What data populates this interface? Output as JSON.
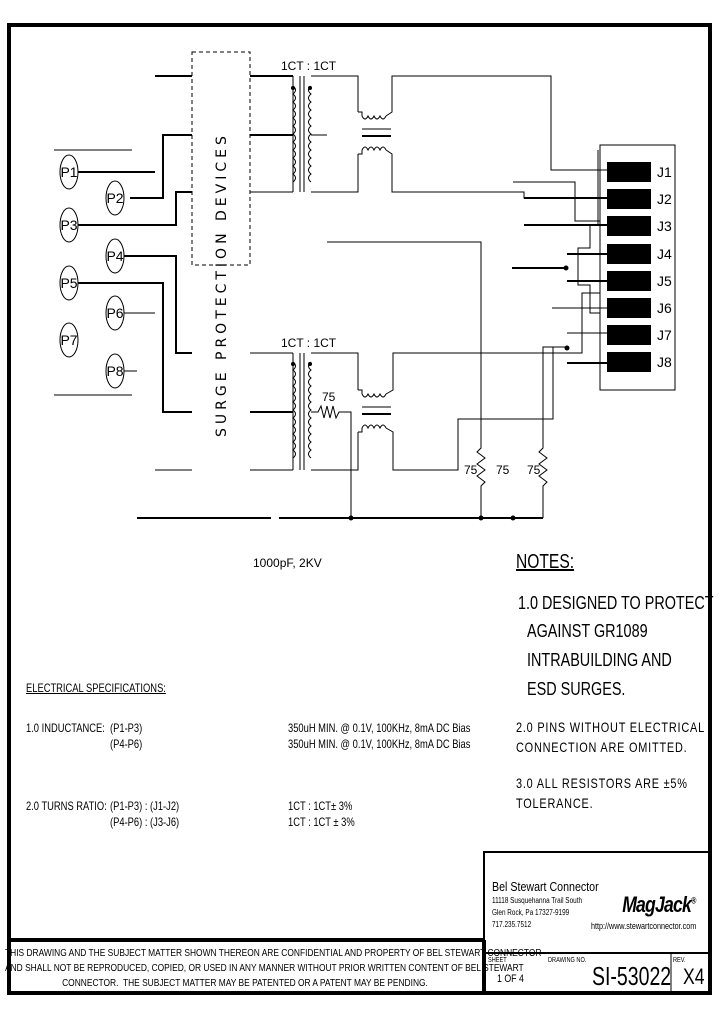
{
  "schematic": {
    "surge_block_label": "SURGE PROTECTION DEVICES",
    "upper_transformer_ratio": "1CT : 1CT",
    "lower_transformer_ratio": "1CT : 1CT",
    "termination_resistor_label": "75",
    "bleed_resistor_labels": [
      "75",
      "75",
      "75"
    ],
    "capacitor_label": "1000pF, 2KV",
    "primary_pins": [
      "P1",
      "P2",
      "P3",
      "P4",
      "P5",
      "P6",
      "P7",
      "P8"
    ],
    "jack_pins": [
      "J1",
      "J2",
      "J3",
      "J4",
      "J5",
      "J6",
      "J7",
      "J8"
    ]
  },
  "notes": {
    "title": "NOTES:",
    "note1_lines": [
      "1.0 DESIGNED TO PROTECT",
      "AGAINST GR1089",
      "INTRABUILDING AND",
      "ESD SURGES."
    ],
    "note2_lines": [
      "2.0 PINS WITHOUT ELECTRICAL",
      "CONNECTION ARE OMITTED."
    ],
    "note3_lines": [
      "3.0 ALL RESISTORS ARE ±5%",
      "TOLERANCE."
    ]
  },
  "electrical_specs": {
    "title": "ELECTRICAL SPECIFICATIONS:",
    "inductance": {
      "label": "1.0 INDUCTANCE:",
      "rows": [
        {
          "pins": "(P1-P3)",
          "value": "350uH MIN. @ 0.1V, 100KHz, 8mA DC Bias"
        },
        {
          "pins": "(P4-P6)",
          "value": "350uH MIN. @ 0.1V, 100KHz, 8mA DC Bias"
        }
      ]
    },
    "turns_ratio": {
      "label": "2.0 TURNS RATIO:",
      "rows": [
        {
          "pins": "(P1-P3) : (J1-J2)",
          "value": "1CT : 1CT± 3%"
        },
        {
          "pins": "(P4-P6) : (J3-J6)",
          "value": "1CT : 1CT ± 3%"
        }
      ]
    }
  },
  "title_block": {
    "company": "Bel Stewart Connector",
    "address_lines": [
      "11118 Susquehanna Trail South",
      "Glen Rock, Pa 17327-9199",
      "717.235.7512"
    ],
    "brand": "MagJack",
    "brand_mark": "®",
    "url": "http://www.stewartconnector.com",
    "sheet_label": "SHEET",
    "sheet_value": "1 OF 4",
    "drawing_no_label": "DRAWING NO.",
    "drawing_no": "SI-53022",
    "rev_label": "REV.",
    "rev_value": "X4"
  },
  "disclaimer_lines": [
    "THIS DRAWING AND THE SUBJECT MATTER SHOWN THEREON ARE CONFIDENTIAL AND PROPERTY OF BEL STEWART CONNECTOR",
    "AND SHALL NOT BE REPRODUCED, COPIED, OR USED IN ANY MANNER WITHOUT PRIOR WRITTEN CONTENT OF BEL STEWART",
    "CONNECTOR.  THE SUBJECT MATTER MAY BE PATENTED OR A PATENT MAY BE PENDING."
  ]
}
